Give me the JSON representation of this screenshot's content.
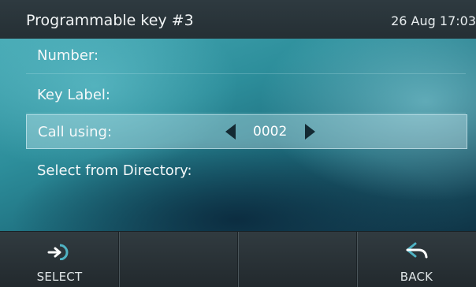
{
  "header": {
    "title": "Programmable key #3",
    "datetime": "26 Aug 17:03"
  },
  "menu": {
    "items": [
      {
        "label": "Number:"
      },
      {
        "label": "Key Label:"
      },
      {
        "label": "Call using:",
        "value": "0002",
        "selected": true
      },
      {
        "label": "Select from Directory:"
      }
    ]
  },
  "softkeys": [
    {
      "label": "SELECT",
      "icon": "select-arrow-icon"
    },
    {
      "label": ""
    },
    {
      "label": ""
    },
    {
      "label": "BACK",
      "icon": "back-arrow-icon"
    }
  ],
  "colors": {
    "accent": "#4fb3c4",
    "header_bg": "#2a353a",
    "softkey_bg": "#2a3338"
  }
}
